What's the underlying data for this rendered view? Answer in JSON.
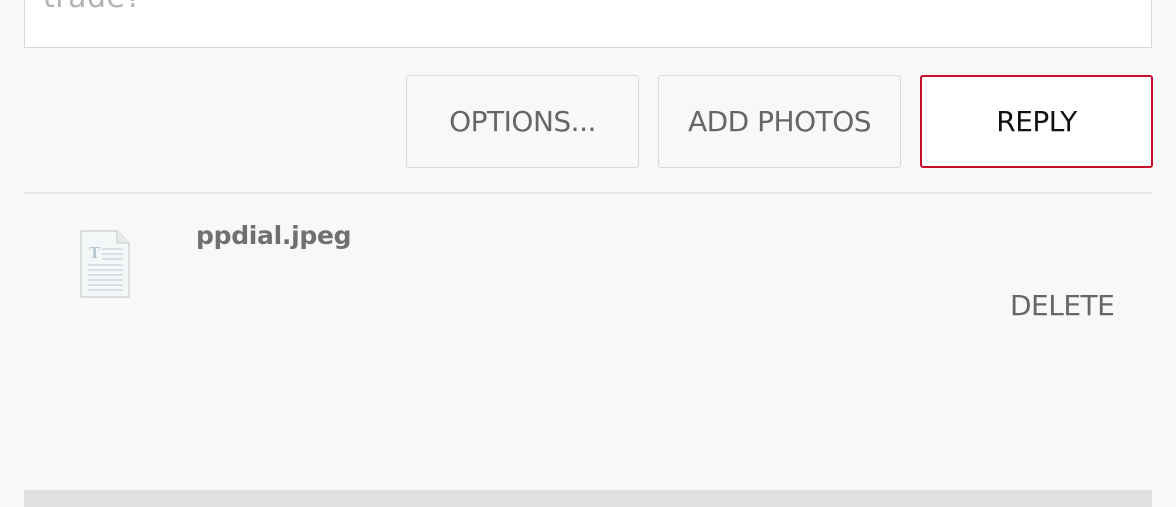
{
  "reply_box": {
    "text": "trade?"
  },
  "actions": {
    "options_label": "OPTIONS...",
    "add_photos_label": "ADD PHOTOS",
    "reply_label": "REPLY"
  },
  "attachments": [
    {
      "icon": "document-icon",
      "file_name": "ppdial.jpeg",
      "delete_label": "DELETE"
    }
  ],
  "colors": {
    "accent": "#c8102e",
    "background": "#f8f8f8",
    "text_muted": "#666666"
  }
}
